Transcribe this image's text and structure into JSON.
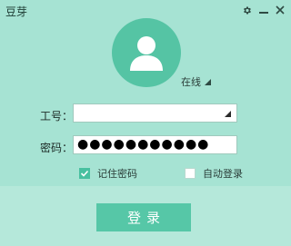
{
  "window": {
    "title": "豆芽",
    "controls": [
      {
        "name": "settings",
        "icon": "gear-icon"
      },
      {
        "name": "minimize",
        "icon": "minimize-icon"
      },
      {
        "name": "close",
        "icon": "close-icon"
      }
    ]
  },
  "profile": {
    "avatar_icon": "user-avatar-icon",
    "status_label": "在线"
  },
  "form": {
    "employee_id": {
      "label": "工号：",
      "value": ""
    },
    "password": {
      "label": "密码：",
      "value": "●●●●●●●●●●●"
    }
  },
  "options": {
    "remember_password": {
      "label": "记住密码",
      "checked": true
    },
    "auto_login": {
      "label": "自动登录",
      "checked": false
    }
  },
  "login_button": {
    "label": "登录"
  },
  "colors": {
    "background": "#a6e3d3",
    "bottom_panel": "#b5e8da",
    "accent": "#55c4a4",
    "button": "#56c7a7"
  }
}
